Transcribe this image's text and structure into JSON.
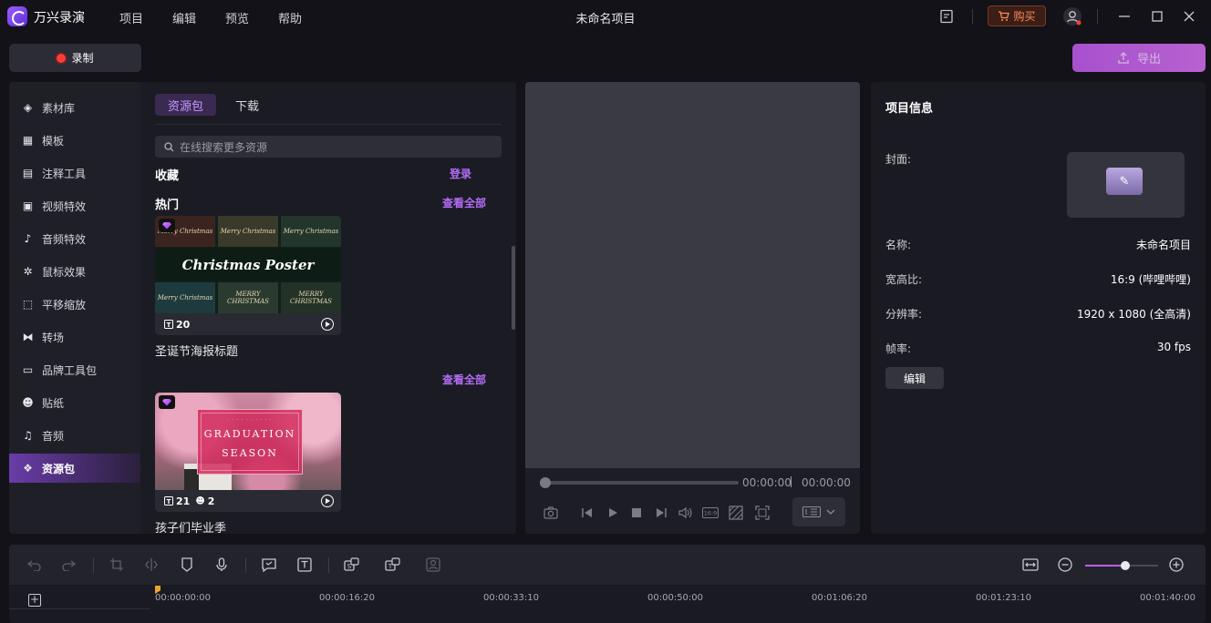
{
  "app": {
    "name": "万兴录演",
    "project_title": "未命名项目",
    "menu": [
      "项目",
      "编辑",
      "预览",
      "帮助"
    ],
    "buy_label": "购买"
  },
  "toolbar": {
    "record_label": "录制",
    "export_label": "导出"
  },
  "sidebar": {
    "items": [
      {
        "label": "素材库",
        "icon": "layers-icon"
      },
      {
        "label": "模板",
        "icon": "template-icon"
      },
      {
        "label": "注释工具",
        "icon": "annotation-icon"
      },
      {
        "label": "视频特效",
        "icon": "video-effects-icon"
      },
      {
        "label": "音频特效",
        "icon": "audio-effects-icon"
      },
      {
        "label": "鼠标效果",
        "icon": "cursor-effects-icon"
      },
      {
        "label": "平移缩放",
        "icon": "pan-zoom-icon"
      },
      {
        "label": "转场",
        "icon": "transition-icon"
      },
      {
        "label": "品牌工具包",
        "icon": "brand-kit-icon"
      },
      {
        "label": "贴纸",
        "icon": "sticker-icon"
      },
      {
        "label": "音频",
        "icon": "music-icon"
      },
      {
        "label": "资源包",
        "icon": "resource-pack-icon",
        "active": true
      }
    ]
  },
  "resources": {
    "tabs": [
      "资源包",
      "下载"
    ],
    "search_placeholder": "在线搜索更多资源",
    "favorites_title": "收藏",
    "login_link": "登录",
    "hot_title": "热门",
    "view_all": "查看全部",
    "cards": [
      {
        "name": "圣诞节海报标题",
        "count": "20",
        "thumb_texts": [
          "Merry Christmas",
          "Merry Christmas",
          "Merry Christmas",
          "Christmas Poster",
          "Merry Christmas",
          "MERRY CHRISTMAS",
          "MERRY CHRISTMAS"
        ]
      },
      {
        "name": "孩子们毕业季",
        "count": "21",
        "sticker_count": "2",
        "thumb_texts": [
          "GRADUATION",
          "SEASON"
        ]
      }
    ]
  },
  "preview": {
    "time_current": "00:00:00",
    "time_total": "00:00:00",
    "progress_fraction": 0
  },
  "project_info": {
    "title": "项目信息",
    "cover_label": "封面:",
    "name_label": "名称:",
    "name_value": "未命名项目",
    "aspect_label": "宽高比:",
    "aspect_value": "16:9 (哔哩哔哩)",
    "resolution_label": "分辨率:",
    "resolution_value": "1920 x 1080 (全高清)",
    "fps_label": "帧率:",
    "fps_value": "30 fps",
    "edit_label": "编辑"
  },
  "timeline": {
    "ticks": [
      "00:00:00:00",
      "00:00:16:20",
      "00:00:33:10",
      "00:00:50:00",
      "00:01:06:20",
      "00:01:23:10",
      "00:01:40:00"
    ],
    "zoom_fraction": 0.55
  },
  "colors": {
    "accent": "#c25cf0",
    "record": "#ff3b3b",
    "buy": "#ff8a5b",
    "link": "#b26df5"
  }
}
